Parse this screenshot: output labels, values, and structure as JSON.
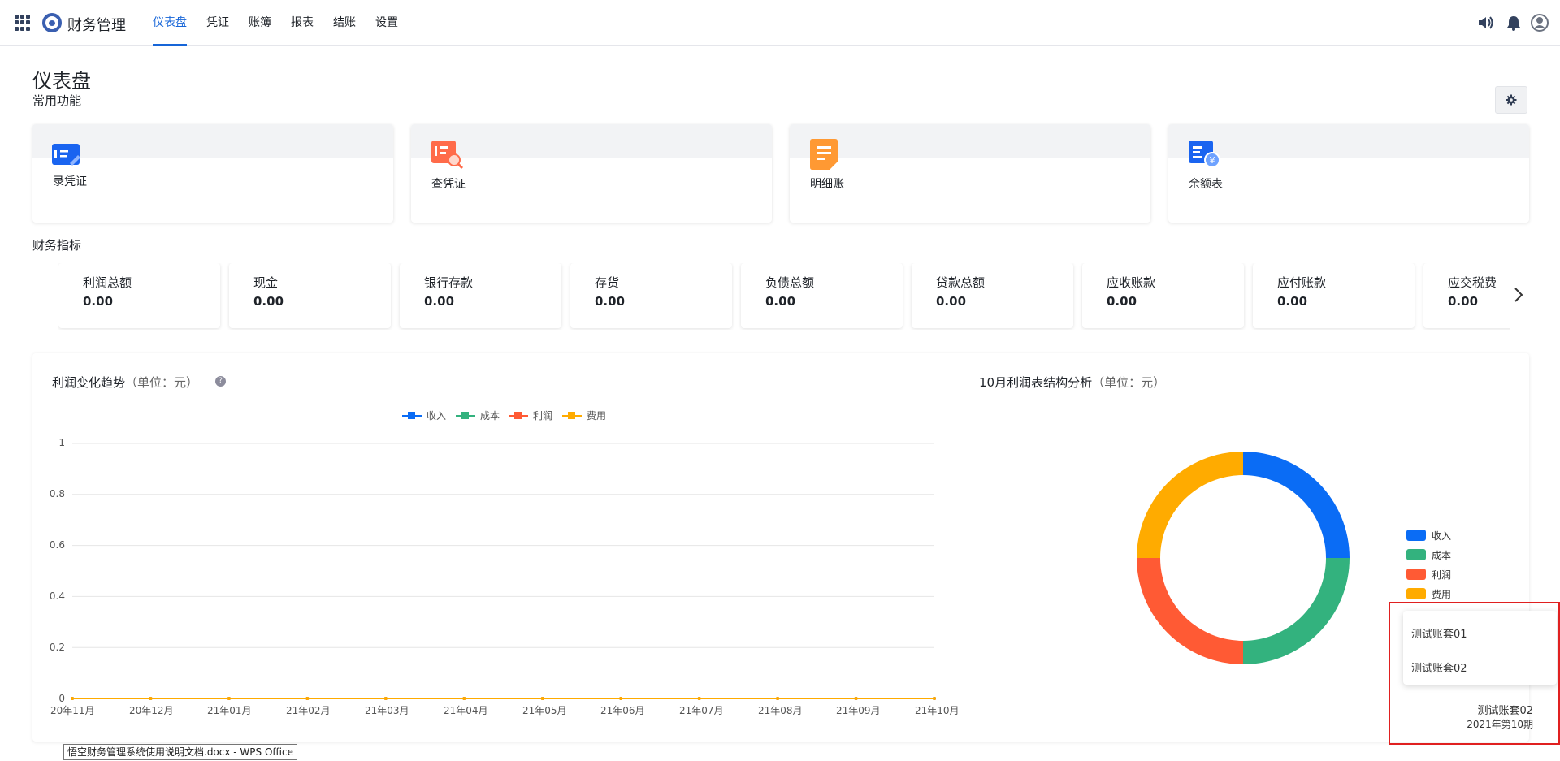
{
  "app": {
    "title": "财务管理"
  },
  "nav": [
    "仪表盘",
    "凭证",
    "账簿",
    "报表",
    "结账",
    "设置"
  ],
  "page": {
    "title": "仪表盘",
    "quick_label": "常用功能",
    "metrics_label": "财务指标"
  },
  "quick_actions": [
    {
      "label": "录凭证",
      "icon": "voucher-entry-icon"
    },
    {
      "label": "查凭证",
      "icon": "voucher-search-icon"
    },
    {
      "label": "明细账",
      "icon": "detail-ledger-icon"
    },
    {
      "label": "余额表",
      "icon": "balance-sheet-icon"
    }
  ],
  "metrics": [
    {
      "name": "利润总额",
      "value": "0.00"
    },
    {
      "name": "现金",
      "value": "0.00"
    },
    {
      "name": "银行存款",
      "value": "0.00"
    },
    {
      "name": "存货",
      "value": "0.00"
    },
    {
      "name": "负债总额",
      "value": "0.00"
    },
    {
      "name": "贷款总额",
      "value": "0.00"
    },
    {
      "name": "应收账款",
      "value": "0.00"
    },
    {
      "name": "应付账款",
      "value": "0.00"
    },
    {
      "name": "应交税费",
      "value": "0.00"
    }
  ],
  "colors": {
    "收入": "#0a6cf5",
    "成本": "#33b27e",
    "利润": "#ff5a34",
    "费用": "#ffab00",
    "accent": "#1665d8"
  },
  "chart_data": [
    {
      "type": "line",
      "title": "利润变化趋势",
      "unit": "（单位：元）",
      "x": [
        "20年11月",
        "20年12月",
        "21年01月",
        "21年02月",
        "21年03月",
        "21年04月",
        "21年05月",
        "21年06月",
        "21年07月",
        "21年08月",
        "21年09月",
        "21年10月"
      ],
      "yticks": [
        "1",
        "0.8",
        "0.6",
        "0.4",
        "0.2",
        "0"
      ],
      "ylim": [
        0,
        1
      ],
      "legend": "top-center",
      "grid": true,
      "series": [
        {
          "name": "收入",
          "values": [
            0,
            0,
            0,
            0,
            0,
            0,
            0,
            0,
            0,
            0,
            0,
            0
          ]
        },
        {
          "name": "成本",
          "values": [
            0,
            0,
            0,
            0,
            0,
            0,
            0,
            0,
            0,
            0,
            0,
            0
          ]
        },
        {
          "name": "利润",
          "values": [
            0,
            0,
            0,
            0,
            0,
            0,
            0,
            0,
            0,
            0,
            0,
            0
          ]
        },
        {
          "name": "费用",
          "values": [
            0,
            0,
            0,
            0,
            0,
            0,
            0,
            0,
            0,
            0,
            0,
            0
          ]
        }
      ]
    },
    {
      "type": "pie",
      "title": "10月利润表结构分析",
      "unit": "（单位：元）",
      "legend": "right",
      "categories": [
        "收入",
        "成本",
        "利润",
        "费用"
      ],
      "values": [
        1,
        1,
        1,
        1
      ]
    }
  ],
  "account": {
    "options": [
      "测试账套01",
      "测试账套02"
    ],
    "current": "测试账套02",
    "period": "2021年第10期"
  },
  "tooltip": "悟空财务管理系统使用说明文档.docx - WPS Office"
}
